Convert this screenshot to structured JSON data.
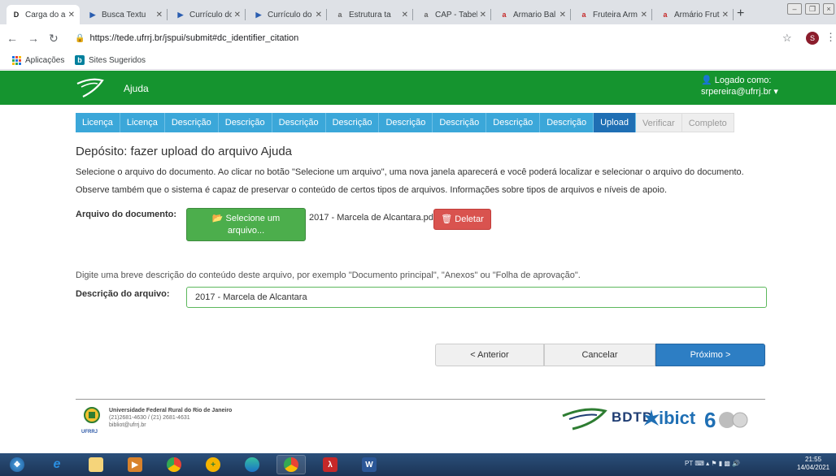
{
  "browser": {
    "tabs": [
      {
        "title": "Carga do ar",
        "favicon": "D",
        "fav_color": "#222"
      },
      {
        "title": "Busca Textu",
        "favicon": "▶",
        "fav_color": "#2a5db0"
      },
      {
        "title": "Currículo do",
        "favicon": "▶",
        "fav_color": "#2a5db0"
      },
      {
        "title": "Currículo do",
        "favicon": "▶",
        "fav_color": "#2a5db0"
      },
      {
        "title": "Estrutura ta",
        "favicon": "a",
        "fav_color": "#666"
      },
      {
        "title": "CAP - Tabel",
        "favicon": "a",
        "fav_color": "#666"
      },
      {
        "title": "Armario Bal",
        "favicon": "a",
        "fav_color": "#c62828"
      },
      {
        "title": "Fruteira Arm",
        "favicon": "a",
        "fav_color": "#c62828"
      },
      {
        "title": "Armário Frut",
        "favicon": "a",
        "fav_color": "#c62828"
      }
    ],
    "new_tab": "+",
    "url": "https://tede.ufrrj.br/jspui/submit#dc_identifier_citation",
    "profile_initial": "S",
    "bookmarks": [
      {
        "label": "Aplicações",
        "icon": "apps-grid-icon"
      },
      {
        "label": "Sites Sugeridos",
        "icon": "bing-icon"
      }
    ]
  },
  "header": {
    "site_name": "Ajuda",
    "logged_label": "Logado como:",
    "user": "srpereira@ufrrj.br"
  },
  "steps": [
    {
      "label": "Licença",
      "state": "done"
    },
    {
      "label": "Licença",
      "state": "done"
    },
    {
      "label": "Descrição",
      "state": "done"
    },
    {
      "label": "Descrição",
      "state": "done"
    },
    {
      "label": "Descrição",
      "state": "done"
    },
    {
      "label": "Descrição",
      "state": "done"
    },
    {
      "label": "Descrição",
      "state": "done"
    },
    {
      "label": "Descrição",
      "state": "done"
    },
    {
      "label": "Descrição",
      "state": "done"
    },
    {
      "label": "Descrição",
      "state": "done"
    },
    {
      "label": "Upload",
      "state": "current"
    },
    {
      "label": "Verificar",
      "state": "future"
    },
    {
      "label": "Completo",
      "state": "future"
    }
  ],
  "main": {
    "title": "Depósito: fazer upload do arquivo Ajuda",
    "intro1": "Selecione o arquivo do documento. Ao clicar no botão \"Selecione um arquivo\", uma nova janela aparecerá e você poderá localizar e selecionar o arquivo do documento.",
    "intro2": "Observe também que o sistema é capaz de preservar o conteúdo de certos tipos de arquivos. Informações sobre tipos de arquivos e níveis de apoio.",
    "file_label": "Arquivo do documento:",
    "select_line1": "Selecione um",
    "select_line2": "arquivo...",
    "file_name": "2017 - Marcela de Alcantara.pdf",
    "delete_label": "Deletar",
    "desc_hint": "Digite uma breve descrição do conteúdo deste arquivo, por exemplo \"Documento principal\", \"Anexos\" ou \"Folha de aprovação\".",
    "desc_label": "Descrição do arquivo:",
    "desc_value": "2017 - Marcela de Alcantara",
    "btn_prev": "< Anterior",
    "btn_cancel": "Cancelar",
    "btn_next": "Próximo >"
  },
  "footer": {
    "org": "Universidade Federal Rural do Rio de Janeiro",
    "phone": "(21)2681-4630 / (21) 2681-4631",
    "email": "bibliot@ufrrj.br",
    "logo_text": "UFRRJ",
    "bdtd": "BDTD",
    "ibict": "ibict"
  },
  "taskbar": {
    "lang": "PT",
    "time": "21:55",
    "date": "14/04/2021"
  }
}
